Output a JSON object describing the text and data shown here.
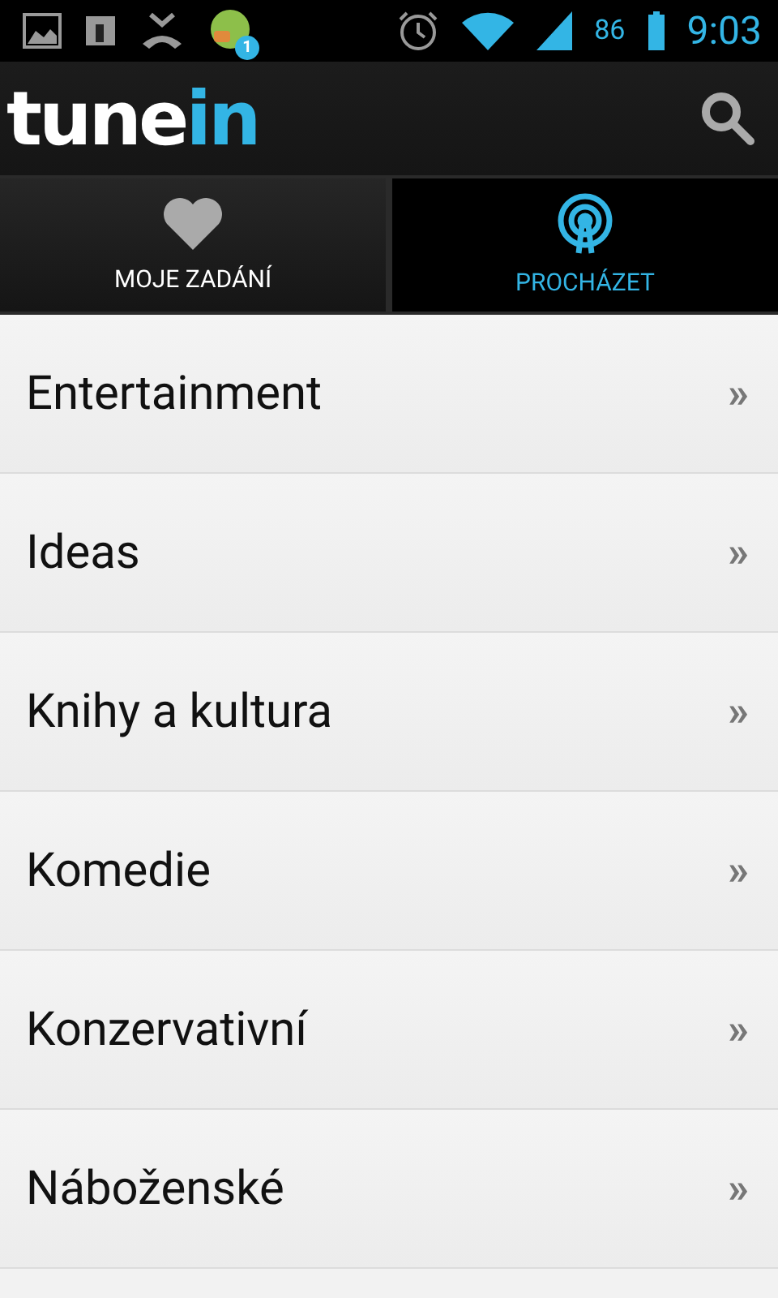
{
  "status_bar": {
    "notification_badge": "1",
    "battery": "86",
    "time": "9:03"
  },
  "header": {
    "logo_main": "tune",
    "logo_accent": "in"
  },
  "tabs": [
    {
      "label": "MOJE ZADÁNÍ",
      "kind": "heart",
      "selected": false
    },
    {
      "label": "PROCHÁZET",
      "kind": "radio",
      "selected": true
    }
  ],
  "categories": [
    {
      "label": "Entertainment",
      "arrow": "»"
    },
    {
      "label": "Ideas",
      "arrow": "»"
    },
    {
      "label": "Knihy a kultura",
      "arrow": "»"
    },
    {
      "label": "Komedie",
      "arrow": "»"
    },
    {
      "label": "Konzervativní",
      "arrow": "»"
    },
    {
      "label": "Náboženské",
      "arrow": "»"
    }
  ]
}
